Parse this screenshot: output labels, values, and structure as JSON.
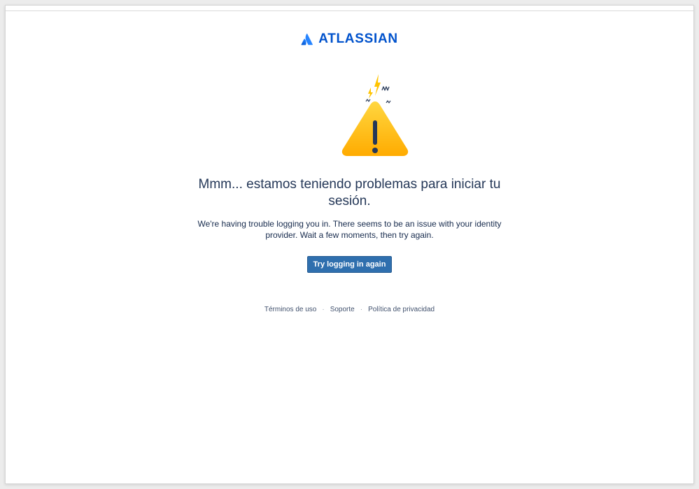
{
  "brand": {
    "name": "ATLASSIAN",
    "color": "#0052cc"
  },
  "error": {
    "heading": "Mmm... estamos teniendo problemas para iniciar tu sesión.",
    "description": "We're having trouble logging you in. There seems to be an issue with your identity provider. Wait a few moments, then try again.",
    "illustration_icon": "warning-triangle-icon",
    "heading_color": "#253858"
  },
  "actions": {
    "retry_label": "Try logging in again",
    "retry_color": "#2f6fae"
  },
  "footer": {
    "links": [
      {
        "label": "Términos de uso"
      },
      {
        "label": "Soporte"
      },
      {
        "label": "Política de privacidad"
      }
    ],
    "separator": "·"
  }
}
